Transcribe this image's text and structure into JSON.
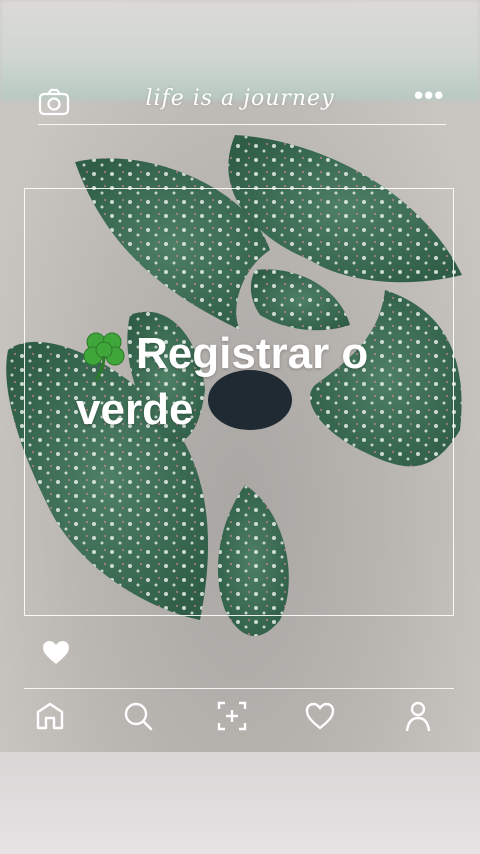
{
  "header": {
    "camera_icon": "camera-icon",
    "title": "life is a journey",
    "more_label": "•••"
  },
  "post": {
    "caption": "Registrar o verde",
    "emoji_icon": "clover-icon",
    "like_icon": "heart-icon"
  },
  "nav": {
    "items": [
      {
        "icon": "home-icon"
      },
      {
        "icon": "search-icon"
      },
      {
        "icon": "add-post-icon"
      },
      {
        "icon": "activity-heart-icon"
      },
      {
        "icon": "profile-icon"
      }
    ]
  },
  "colors": {
    "overlay_text": "#ffffff",
    "leaf_green": "#3c6e55",
    "leaf_spot": "#d97a7e"
  }
}
